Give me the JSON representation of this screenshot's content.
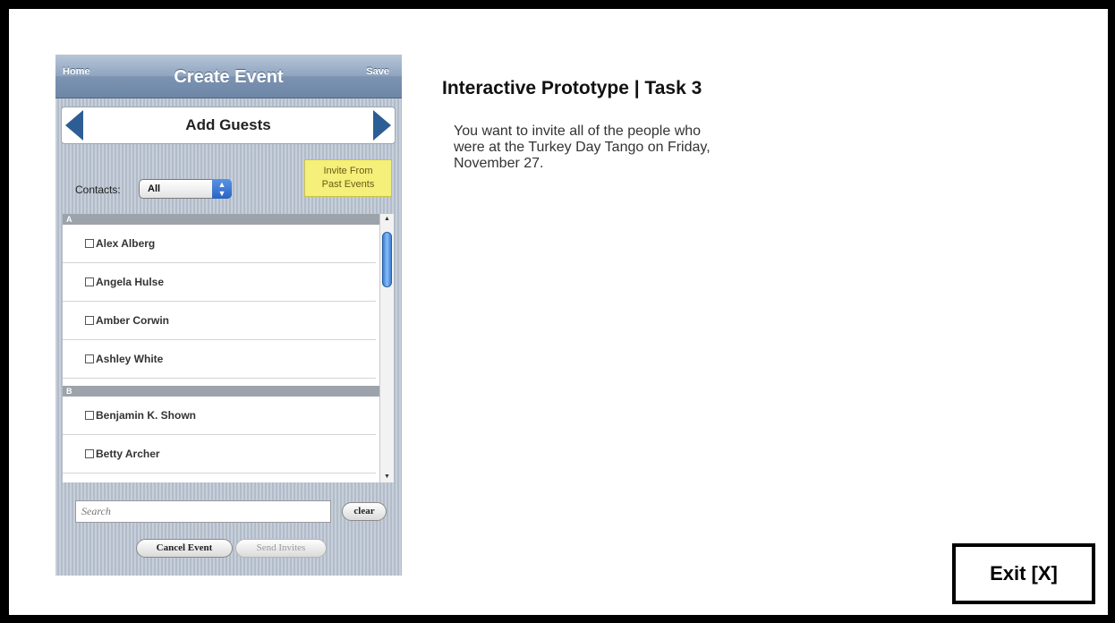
{
  "phone": {
    "navbar": {
      "left": "Home",
      "title": "Create Event",
      "right": "Save"
    },
    "guest_bar": {
      "title": "Add Guests"
    },
    "invite_past": {
      "line1": "Invite From",
      "line2": "Past Events"
    },
    "contacts": {
      "label": "Contacts:",
      "selected": "All"
    },
    "sections": [
      {
        "header": "A",
        "contacts": [
          "Alex Alberg",
          "Angela Hulse",
          "Amber Corwin",
          "Ashley White"
        ]
      },
      {
        "header": "B",
        "contacts": [
          "Benjamin K. Shown",
          "Betty Archer"
        ]
      }
    ],
    "search": {
      "placeholder": "Search",
      "clear_label": "clear"
    },
    "actions": {
      "cancel_label": "Cancel Event",
      "send_label": "Send Invites"
    }
  },
  "task": {
    "title": "Interactive Prototype | Task 3",
    "description_lines": [
      "You want to invite all of the people who",
      "were at the Turkey Day Tango on Friday,",
      "November 27."
    ]
  },
  "exit_label": "Exit [X]"
}
